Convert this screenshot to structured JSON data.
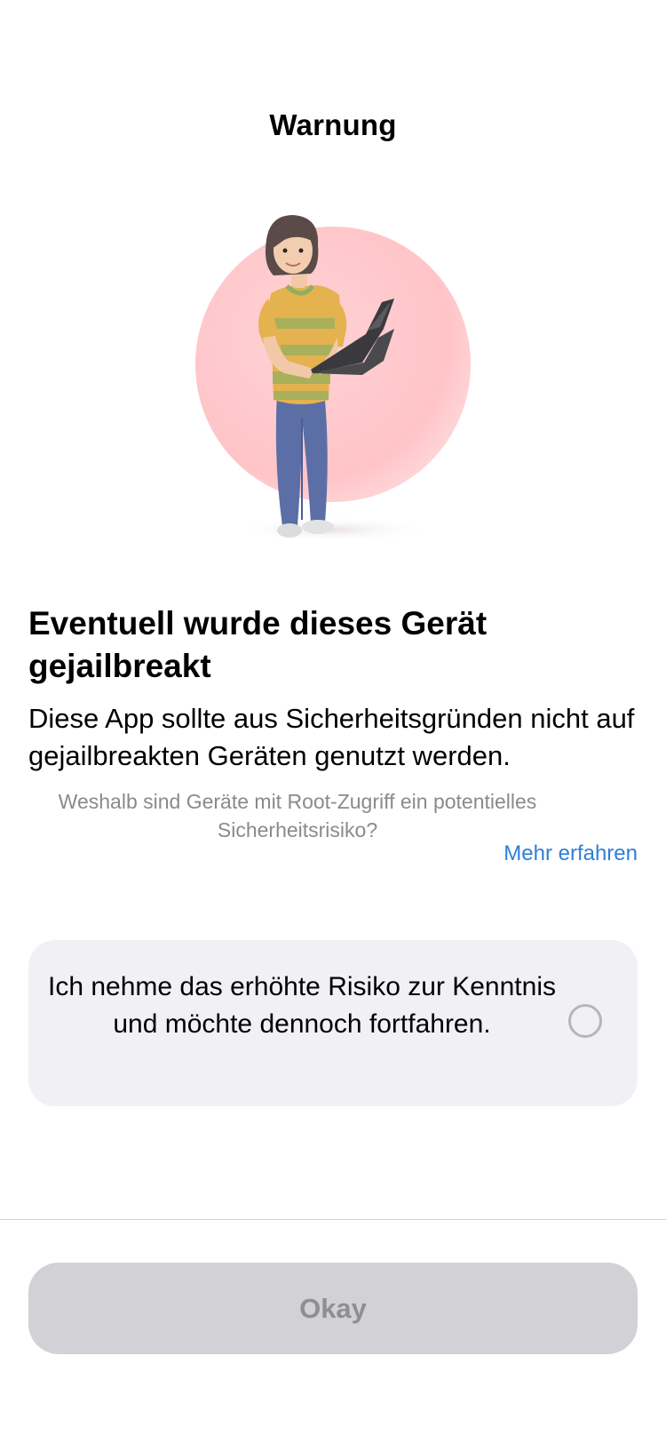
{
  "nav": {
    "title": "Warnung"
  },
  "illustration": {
    "icon": "woman-with-laptop-illustration",
    "circle_color": "#ffc9cc"
  },
  "warning": {
    "headline": "Eventuell wurde dieses Gerät gejailbreakt",
    "body": "Diese App sollte aus Sicherheitsgründen nicht auf gejailbreakten Geräten genutzt werden.",
    "question": "Weshalb sind Geräte mit Root-Zugriff ein potentielles Sicherheitsrisiko?",
    "more_link": "Mehr erfahren"
  },
  "consent": {
    "text": "Ich nehme das erhöhte Risiko zur Kenntnis und möchte dennoch fortfahren.",
    "checked": false
  },
  "footer": {
    "button_label": "Okay",
    "button_enabled": false
  },
  "colors": {
    "link": "#2f7fd6",
    "card_bg": "#f1f1f5",
    "button_disabled_bg": "#d1d1d6",
    "button_disabled_text": "#8e8e93"
  }
}
